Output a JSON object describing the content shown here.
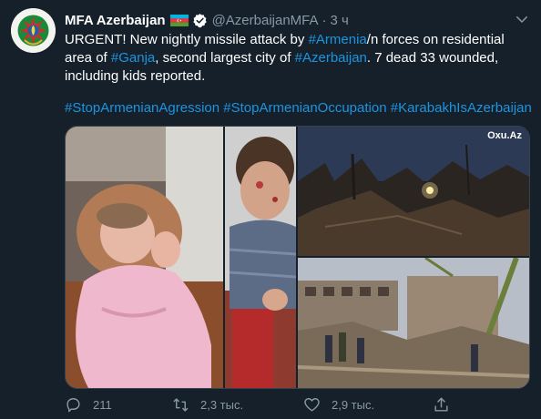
{
  "author": {
    "name": "MFA Azerbaijan",
    "handle": "@AzerbaijanMFA",
    "separator": "·",
    "time": "3 ч"
  },
  "tweet": {
    "line1_a": "URGENT! New nightly missile attack by ",
    "tag_armenia": "#Armenia",
    "line1_b": "/n forces on residential",
    "line2_a": "area of ",
    "tag_ganja": "#Ganja",
    "line2_b": ", second largest city of ",
    "tag_azerbaijan": "#Azerbaijan",
    "line2_c": ". 7 dead 33 wounded,",
    "line3": "including kids reported.",
    "hashtags": [
      "#StopArmenianAgression",
      "#StopArmenianOccupation",
      "#KarabakhIsAzerbaijan"
    ]
  },
  "media": {
    "watermark": "Oxu.Az"
  },
  "actions": {
    "reply_count": "211",
    "retweet_count": "2,3 тыс.",
    "like_count": "2,9 тыс."
  },
  "icons": {
    "reply": "reply-icon",
    "retweet": "retweet-icon",
    "like": "heart-icon",
    "share": "share-icon",
    "verified": "verified-badge-icon",
    "flag": "azerbaijan-flag-icon",
    "caret": "chevron-down-icon"
  },
  "colors": {
    "background": "#15202b",
    "link": "#1b95e0",
    "muted": "#8899a6"
  }
}
